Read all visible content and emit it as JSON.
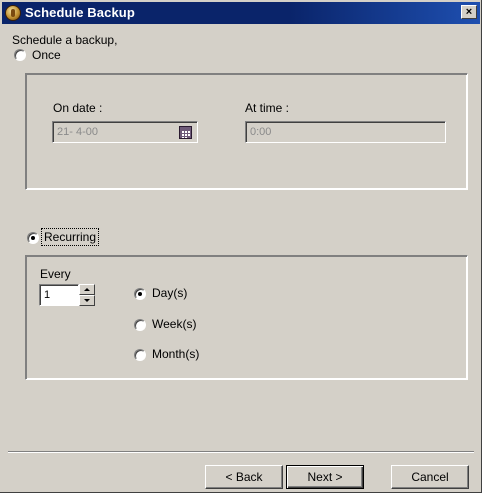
{
  "window": {
    "title": "Schedule Backup",
    "close_glyph": "×"
  },
  "schedule": {
    "prompt": "Schedule a backup,",
    "once_label": "Once",
    "recurring_label": "Recurring",
    "selected_mode": "Recurring"
  },
  "once_group": {
    "date_label": "On date :",
    "date_value": "21- 4-00",
    "time_label": "At time :",
    "time_value": "0:00",
    "enabled": false
  },
  "recurring_group": {
    "every_label": "Every",
    "interval_value": "1",
    "unit_options": [
      "Day(s)",
      "Week(s)",
      "Month(s)"
    ],
    "selected_unit": "Day(s)"
  },
  "buttons": {
    "back": "< Back",
    "next": "Next >",
    "cancel": "Cancel"
  },
  "icons": {
    "app": "backup-app-icon",
    "calendar": "calendar-icon"
  }
}
